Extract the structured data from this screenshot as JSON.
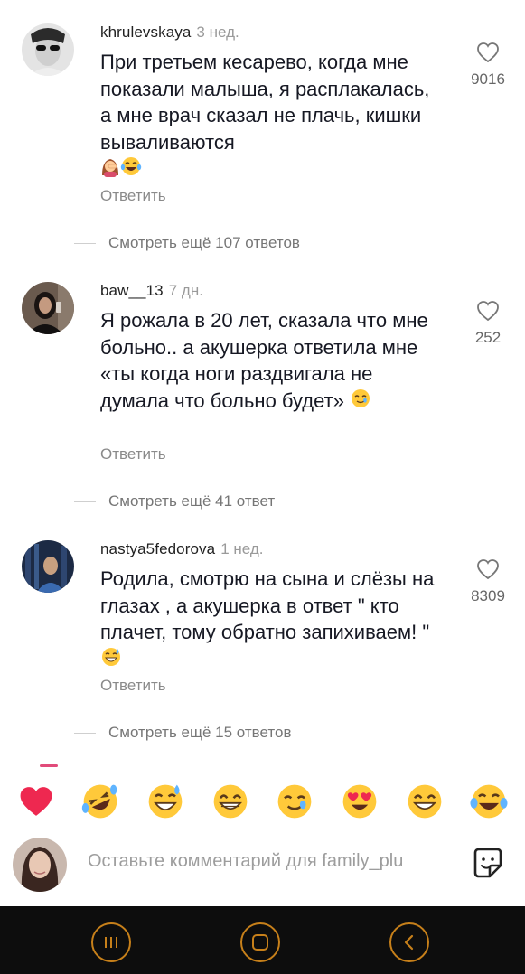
{
  "comments": [
    {
      "username": "khrulevskaya",
      "ago": "3 нед.",
      "text": "При третьем кесарево, когда мне показали малыша, я расплакалась, а мне врач сказал не плачь, кишки вываливаются",
      "emoji_after": [
        "woman-facepalm-emoji",
        "tears-of-joy-emoji"
      ],
      "reply_label": "Ответить",
      "likes": "9016",
      "more_replies": "Смотреть ещё 107 ответов"
    },
    {
      "username": "baw__13",
      "ago": "7 дн.",
      "text": "Я рожала в 20 лет, сказала что мне больно.. а акушерка ответила мне «ты когда ноги раздвигала не думала что больно будет»",
      "emoji_after": [
        "smiling-with-tear-emoji"
      ],
      "reply_label": "Ответить",
      "likes": "252",
      "more_replies": "Смотреть ещё 41 ответ"
    },
    {
      "username": "nastya5fedorova",
      "ago": "1 нед.",
      "text": "Родила, смотрю на сына и слёзы на глазах , а акушерка в ответ \" кто плачет, тому обратно запихиваем! \"",
      "emoji_after": [
        "grinning-sweat-emoji"
      ],
      "reply_label": "Ответить",
      "likes": "8309",
      "more_replies": "Смотреть ещё 15 ответов"
    }
  ],
  "quick_emojis": [
    "red-heart",
    "rolling-on-floor-laughing",
    "grinning-sweat",
    "beaming-grin",
    "smiling-with-tear",
    "heart-eyes",
    "grinning",
    "tears-of-joy"
  ],
  "input": {
    "placeholder": "Оставьте комментарий для family_plu"
  },
  "colors": {
    "nav_accent": "#c7801a",
    "nav_background": "#0d0d0d",
    "emoji_yellow": "#ffc93a"
  }
}
